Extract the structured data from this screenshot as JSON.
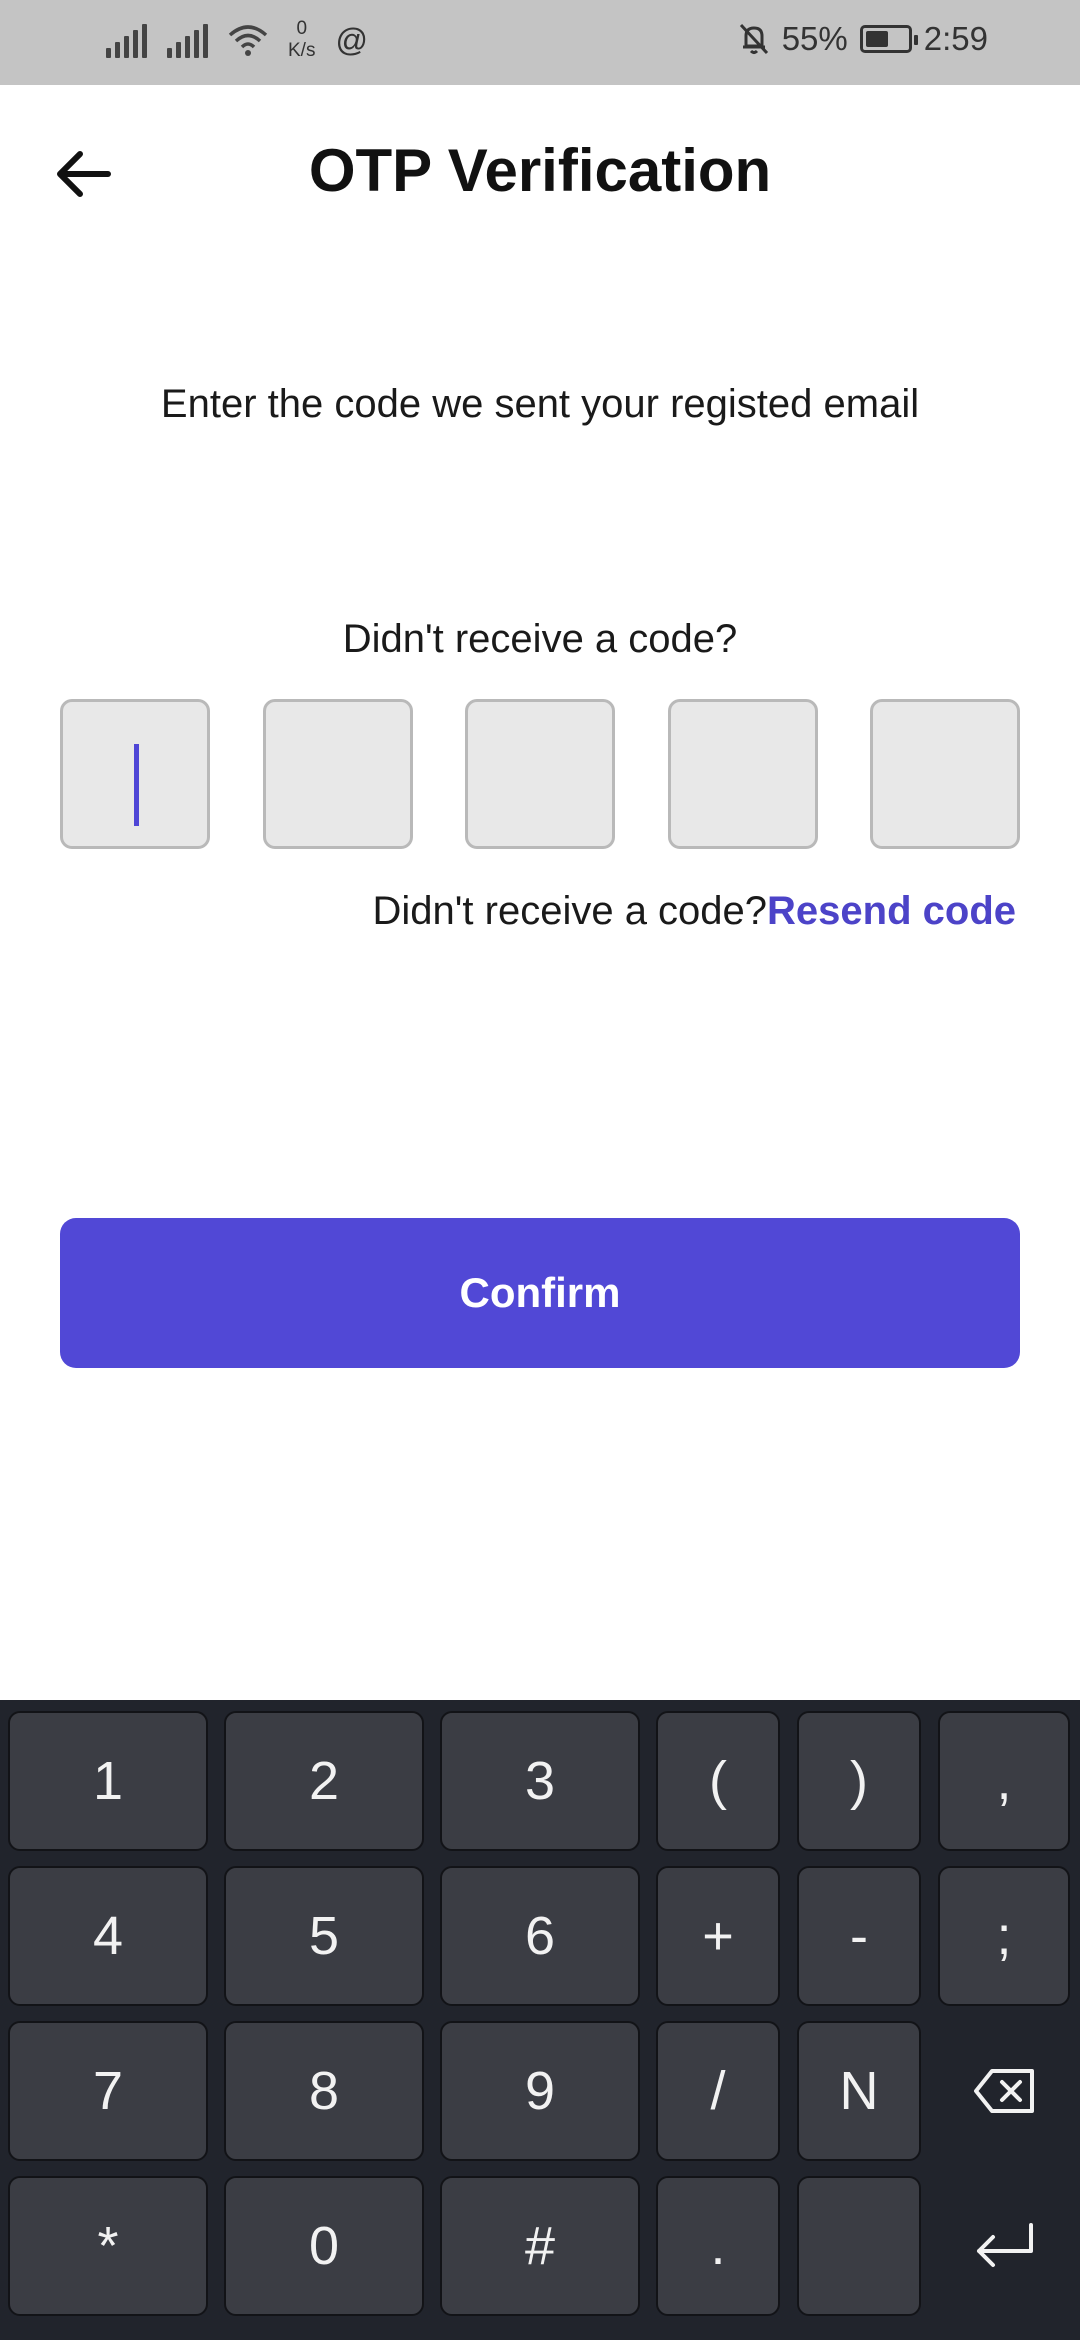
{
  "status_bar": {
    "net_speed_value": "0",
    "net_speed_unit": "K/s",
    "threads_icon": "@",
    "battery_percent": "55%",
    "battery_level": 0.55,
    "time": "2:59"
  },
  "header": {
    "title": "OTP Verification",
    "back_icon": "arrow-left"
  },
  "main": {
    "subtitle": "Enter the code we sent your registed email",
    "prompt": "Didn't receive a code?",
    "otp_boxes": [
      "",
      "",
      "",
      "",
      ""
    ],
    "resend_prefix": "Didn't receive a code?",
    "resend_link": "Resend code",
    "confirm_label": "Confirm"
  },
  "colors": {
    "accent": "#5148d6",
    "link": "#4c43c8",
    "status_bar_bg": "#c4c4c4",
    "keyboard_bg": "#21242c",
    "key_bg": "#3b3d44"
  },
  "keyboard": {
    "rows": [
      [
        "1",
        "2",
        "3",
        "(",
        ")",
        ","
      ],
      [
        "4",
        "5",
        "6",
        "+",
        "-",
        ";"
      ],
      [
        "7",
        "8",
        "9",
        "/",
        "N",
        "backspace-icon"
      ],
      [
        "*",
        "0",
        "#",
        ".",
        "",
        "enter-icon"
      ]
    ]
  }
}
